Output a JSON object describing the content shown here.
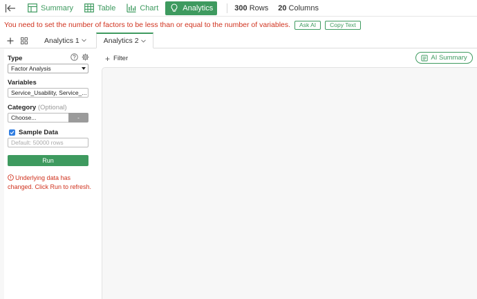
{
  "toolbar": {
    "tabs": [
      {
        "label": "Summary",
        "icon": "summary-icon",
        "active": false
      },
      {
        "label": "Table",
        "icon": "table-icon",
        "active": false
      },
      {
        "label": "Chart",
        "icon": "chart-icon",
        "active": false
      },
      {
        "label": "Analytics",
        "icon": "lightbulb-icon",
        "active": true
      }
    ],
    "rows_count": "300",
    "rows_label": "Rows",
    "cols_count": "20",
    "cols_label": "Columns"
  },
  "banner": {
    "message": "You need to set the number of factors to be less than or equal to the number of variables.",
    "ask_ai_label": "Ask AI",
    "copy_text_label": "Copy Text"
  },
  "analytics_tabs": [
    {
      "label": "Analytics 1",
      "active": false
    },
    {
      "label": "Analytics 2",
      "active": true
    }
  ],
  "panel": {
    "type_label": "Type",
    "type_value": "Factor Analysis",
    "variables_label": "Variables",
    "variables_value": "Service_Usability, Service_...",
    "category_label": "Category",
    "category_optional": "(Optional)",
    "category_placeholder": "Choose...",
    "category_button": "-",
    "sample_label": "Sample Data",
    "sample_checked": true,
    "sample_placeholder": "Default: 50000 rows",
    "run_label": "Run",
    "warning": "Underlying data has changed. Click Run to refresh."
  },
  "main": {
    "filter_label": "Filter",
    "ai_summary_label": "AI Summary"
  },
  "colors": {
    "accent": "#3e9a5f",
    "error": "#d0321e",
    "checkbox": "#2f7de1"
  }
}
